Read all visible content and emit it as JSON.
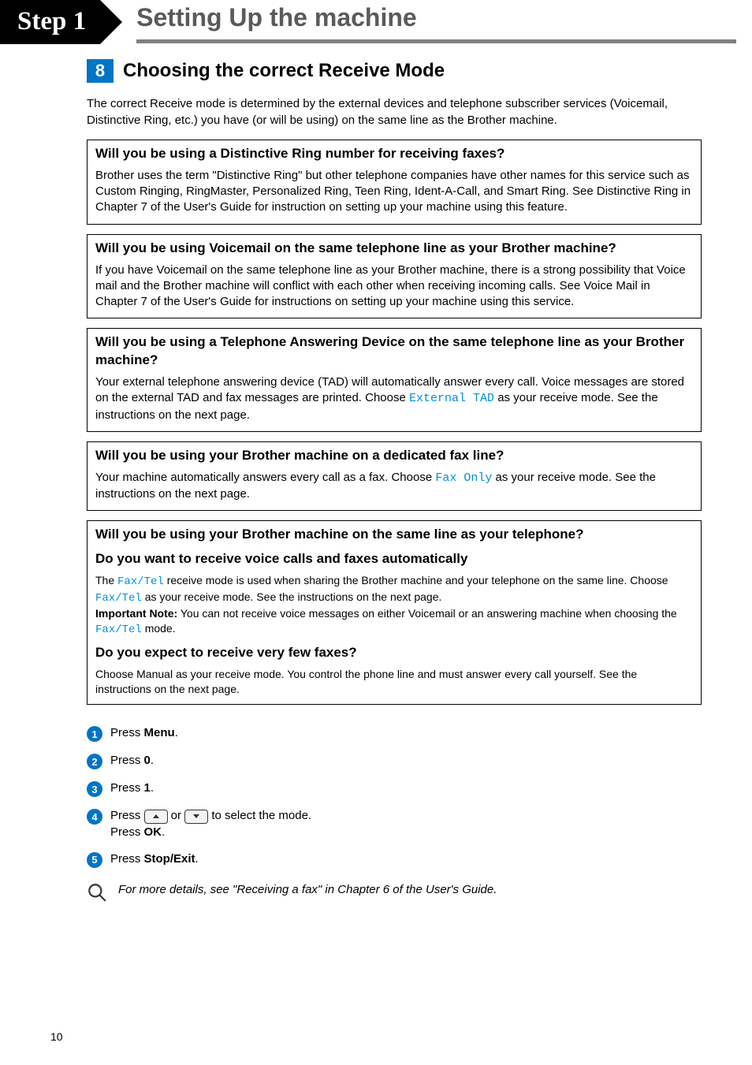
{
  "header": {
    "step_label": "Step 1",
    "title": "Setting Up the machine"
  },
  "section": {
    "number": "8",
    "title": "Choosing the correct Receive Mode",
    "intro": "The correct Receive mode is determined by the external devices and telephone subscriber services (Voicemail, Distinctive Ring, etc.) you have (or will be using) on the same line as the Brother machine."
  },
  "boxes": {
    "b1": {
      "title": "Will you be using a Distinctive Ring number for receiving faxes?",
      "body": "Brother uses the term \"Distinctive Ring\" but other telephone companies have other names for this service such as Custom Ringing, RingMaster, Personalized Ring, Teen Ring, Ident-A-Call, and Smart Ring. See Distinctive Ring in Chapter 7 of the User's Guide for instruction on setting up your machine using this feature."
    },
    "b2": {
      "title": "Will you be using Voicemail on the same telephone line as your Brother machine?",
      "body": "If you have Voicemail on the same telephone line as your Brother machine, there is a strong possibility that Voice mail and the Brother machine will conflict with each other when receiving incoming calls. See Voice Mail in Chapter 7 of the User's Guide for instructions on setting up your machine using this service."
    },
    "b3": {
      "title": "Will you be using a Telephone Answering Device on the same telephone line as your Brother machine?",
      "body_pre": "Your external telephone answering device (TAD) will automatically answer every call.  Voice messages are stored on the external TAD and fax messages are printed.  Choose ",
      "mono": "External TAD",
      "body_post": " as your receive mode. See the instructions on the next page."
    },
    "b4": {
      "title": "Will you be using your Brother machine on a dedicated fax line?",
      "body_pre": "Your machine automatically answers every call as a fax.  Choose ",
      "mono": "Fax Only",
      "body_post": " as your receive mode. See the instructions on the next page."
    },
    "b5": {
      "title": "Will you be using your Brother machine on the same line as your telephone?",
      "sub1_title": "Do you want to receive voice calls and faxes automatically",
      "sub1_pre": "The ",
      "sub1_mono1": "Fax/Tel",
      "sub1_mid": " receive mode is used when sharing the Brother machine and your telephone on the same line. Choose ",
      "sub1_mono2": "Fax/Tel",
      "sub1_post": " as your receive mode.  See the instructions on the next page.",
      "sub1_note_label": "Important Note:",
      "sub1_note_pre": " You can not receive voice messages on either Voicemail or an answering machine when choosing the ",
      "sub1_note_mono": "Fax/Tel",
      "sub1_note_post": " mode.",
      "sub2_title": "Do you expect to receive very few faxes?",
      "sub2_body": "Choose Manual as your receive mode. You control the phone line and must answer every call yourself. See the instructions on the next page."
    }
  },
  "steps": {
    "s1_pre": "Press ",
    "s1_key": "Menu",
    "s1_post": ".",
    "s2_pre": "Press ",
    "s2_key": "0",
    "s2_post": ".",
    "s3_pre": "Press ",
    "s3_key": "1",
    "s3_post": ".",
    "s4_pre": "Press ",
    "s4_or": " or ",
    "s4_mid": " to select the mode.",
    "s4_line2_pre": "Press ",
    "s4_line2_key": "OK",
    "s4_line2_post": ".",
    "s5_pre": "Press ",
    "s5_key": "Stop/Exit",
    "s5_post": "."
  },
  "footnote": "For more details, see \"Receiving a fax\" in Chapter 6 of the User's Guide.",
  "page_number": "10"
}
